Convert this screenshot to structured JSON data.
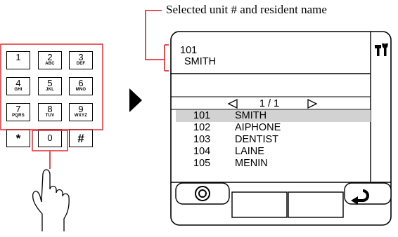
{
  "caption": "Selected unit # and resident name",
  "keypad": {
    "keys": [
      {
        "num": "1",
        "letters": ""
      },
      {
        "num": "2",
        "letters": "ABC"
      },
      {
        "num": "3",
        "letters": "DEF"
      },
      {
        "num": "4",
        "letters": "GHI"
      },
      {
        "num": "5",
        "letters": "JKL"
      },
      {
        "num": "6",
        "letters": "MNO"
      },
      {
        "num": "7",
        "letters": "PQRS"
      },
      {
        "num": "8",
        "letters": "TUV"
      },
      {
        "num": "9",
        "letters": "WXYZ"
      },
      {
        "num": "*",
        "letters": ""
      },
      {
        "num": "0",
        "letters": ""
      },
      {
        "num": "#",
        "letters": ""
      }
    ]
  },
  "screen": {
    "selected_unit": "101",
    "selected_name": "SMITH",
    "page_indicator": "1 / 1",
    "rows": [
      {
        "unit": "101",
        "name": "SMITH",
        "selected": true
      },
      {
        "unit": "102",
        "name": "AIPHONE",
        "selected": false
      },
      {
        "unit": "103",
        "name": "DENTIST",
        "selected": false
      },
      {
        "unit": "104",
        "name": "LAINE",
        "selected": false
      },
      {
        "unit": "105",
        "name": "MENIN",
        "selected": false
      }
    ]
  },
  "icons": {
    "arrow": "right-triangle-icon",
    "hand": "pointing-hand-icon",
    "settings": "tools-icon",
    "prev": "left-triangle-icon",
    "next": "right-triangle-icon",
    "call": "circle-call-icon",
    "back": "return-arrow-icon"
  },
  "colors": {
    "highlight": "#e0393e",
    "selected_row": "#d2d2d2",
    "line": "#000000"
  }
}
